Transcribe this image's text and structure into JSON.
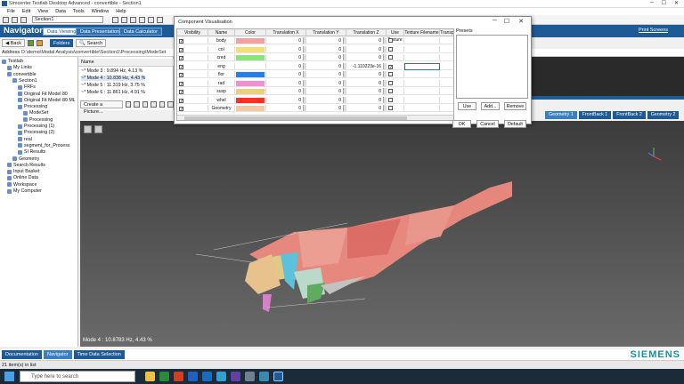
{
  "window": {
    "title": "Simcenter Testlab Desktop Advanced - convertible - Section1",
    "controls": [
      "─",
      "☐",
      "✕"
    ]
  },
  "menu": [
    "File",
    "Edit",
    "View",
    "Data",
    "Tools",
    "Window",
    "Help"
  ],
  "toolbar": {
    "section_combo": "Section1"
  },
  "navigator": {
    "title": "Navigator",
    "tabs": [
      "Data Viewing",
      "Data Presentation",
      "Data Calculator"
    ],
    "print_screens": "Print Screens",
    "back": "Back",
    "folders": "Folders",
    "search": "Search"
  },
  "address": {
    "label": "Address",
    "value": "D:\\demo\\Modal Analysis\\convertible\\Section1\\Processing\\ModeSet"
  },
  "tree": [
    {
      "label": "Testlab",
      "indent": 0
    },
    {
      "label": "My Links",
      "indent": 1
    },
    {
      "label": "convertible",
      "indent": 1
    },
    {
      "label": "Section1",
      "indent": 2
    },
    {
      "label": "FRFs",
      "indent": 3
    },
    {
      "label": "Original Fit Model 80",
      "indent": 3
    },
    {
      "label": "Original Fit Model 80 ML",
      "indent": 3
    },
    {
      "label": "Processing",
      "indent": 3
    },
    {
      "label": "ModeSet",
      "indent": 4
    },
    {
      "label": "Processing",
      "indent": 4
    },
    {
      "label": "Processing (1)",
      "indent": 3
    },
    {
      "label": "Processing (2)",
      "indent": 3
    },
    {
      "label": "real",
      "indent": 3
    },
    {
      "label": "segment_for_Process",
      "indent": 3
    },
    {
      "label": "SI Results",
      "indent": 3
    },
    {
      "label": "Geometry",
      "indent": 2
    },
    {
      "label": "Search Results",
      "indent": 1
    },
    {
      "label": "Input Basket",
      "indent": 1
    },
    {
      "label": "Online Data",
      "indent": 1
    },
    {
      "label": "Workspace",
      "indent": 1
    },
    {
      "label": "My Computer",
      "indent": 1
    }
  ],
  "list": {
    "header": "Name",
    "items": [
      "Mode 3 : 9.894 Hz, 4.13 %",
      "Mode 4 : 10.838 Hz, 4.43 %",
      "Mode 5 : 11.319 Hz, 3.75 %",
      "Mode 6 : 11.861 Hz, 4.91 %"
    ],
    "create_picture": "Create a Picture..."
  },
  "geometry_tabs": [
    "Geometry 1",
    "FrontBack 1",
    "FrontBack 2",
    "Geometry 2"
  ],
  "viewport": {
    "status": "Mode 4 : 10.8783 Hz, 4.43 %"
  },
  "bottom_tabs": [
    "Documentation",
    "Navigator",
    "Time Data Selection"
  ],
  "brand": "SIEMENS",
  "statusbar": "21 item(s) in list",
  "taskbar": {
    "search_placeholder": "Type here to search"
  },
  "dialog": {
    "title": "Component Visualisation",
    "columns": [
      "Visibility",
      "Name",
      "Color",
      "Translation X",
      "Translation Y",
      "Translation Z",
      "Use Texture",
      "Texture Filename",
      "Transp"
    ],
    "rows": [
      {
        "name": "body",
        "color": "#f4a0a0",
        "tx": "0",
        "ty": "0",
        "tz": "0",
        "tex": false
      },
      {
        "name": "col",
        "color": "#f4e070",
        "tx": "0",
        "ty": "0",
        "tz": "0",
        "tex": false
      },
      {
        "name": "cred",
        "color": "#8ee080",
        "tx": "0",
        "ty": "0",
        "tz": "0",
        "tex": false
      },
      {
        "name": "eng",
        "color": "#ffffff",
        "tx": "0",
        "ty": "0",
        "tz": "-1.110223e-16",
        "tex": true
      },
      {
        "name": "flor",
        "color": "#2080f0",
        "tx": "0",
        "ty": "0",
        "tz": "0",
        "tex": false
      },
      {
        "name": "rad",
        "color": "#f090d0",
        "tx": "0",
        "ty": "0",
        "tz": "0",
        "tex": false
      },
      {
        "name": "susp",
        "color": "#e8d080",
        "tx": "0",
        "ty": "0",
        "tz": "0",
        "tex": false
      },
      {
        "name": "whel",
        "color": "#ff3020",
        "tx": "0",
        "ty": "0",
        "tz": "0",
        "tex": false
      },
      {
        "name": "Geometry",
        "color": "#f4c8a0",
        "tx": "0",
        "ty": "0",
        "tz": "0",
        "tex": false
      }
    ],
    "presets_label": "Presets",
    "use": "Use",
    "add": "Add...",
    "remove": "Remove",
    "ok": "OK",
    "cancel": "Cancel",
    "default": "Default"
  }
}
